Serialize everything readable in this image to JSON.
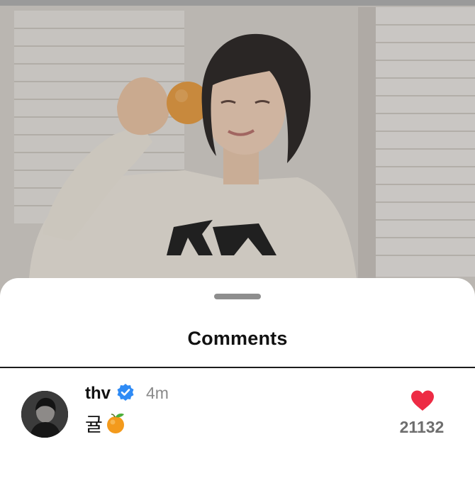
{
  "sheet": {
    "title": "Comments"
  },
  "comment": {
    "username": "thv",
    "verified": true,
    "time": "4m",
    "text": "귤",
    "emoji": "tangerine-emoji",
    "like_count": "21132",
    "liked": true
  },
  "colors": {
    "like_red": "#ed2b44",
    "verified_blue": "#2f8bf5",
    "orange": "#f39a1c"
  }
}
